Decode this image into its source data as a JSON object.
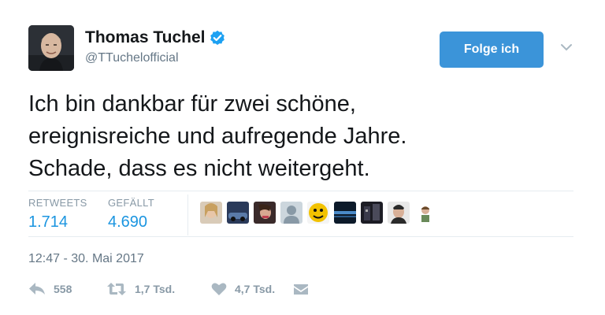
{
  "header": {
    "name": "Thomas Tuchel",
    "handle": "@TTuchelofficial",
    "follow_label": "Folge ich"
  },
  "tweet": {
    "lines": [
      "Ich bin dankbar für zwei schöne,",
      "ereignisreiche und aufregende Jahre.",
      "Schade, dass es nicht weitergeht."
    ]
  },
  "stats": {
    "retweets_label": "RETWEETS",
    "retweets_value": "1.714",
    "likes_label": "GEFÄLLT",
    "likes_value": "4.690"
  },
  "likers": [
    "avatar",
    "avatar",
    "avatar",
    "avatar",
    "avatar",
    "avatar",
    "avatar",
    "avatar",
    "avatar",
    "avatar"
  ],
  "timestamp": "12:47 - 30. Mai 2017",
  "actions": {
    "reply_count": "558",
    "retweet_count": "1,7 Tsd.",
    "like_count": "4,7 Tsd."
  },
  "colors": {
    "accent": "#1b95e0",
    "follow_button": "#3b94d9",
    "muted": "#657786",
    "verified": "#1da1f2"
  }
}
